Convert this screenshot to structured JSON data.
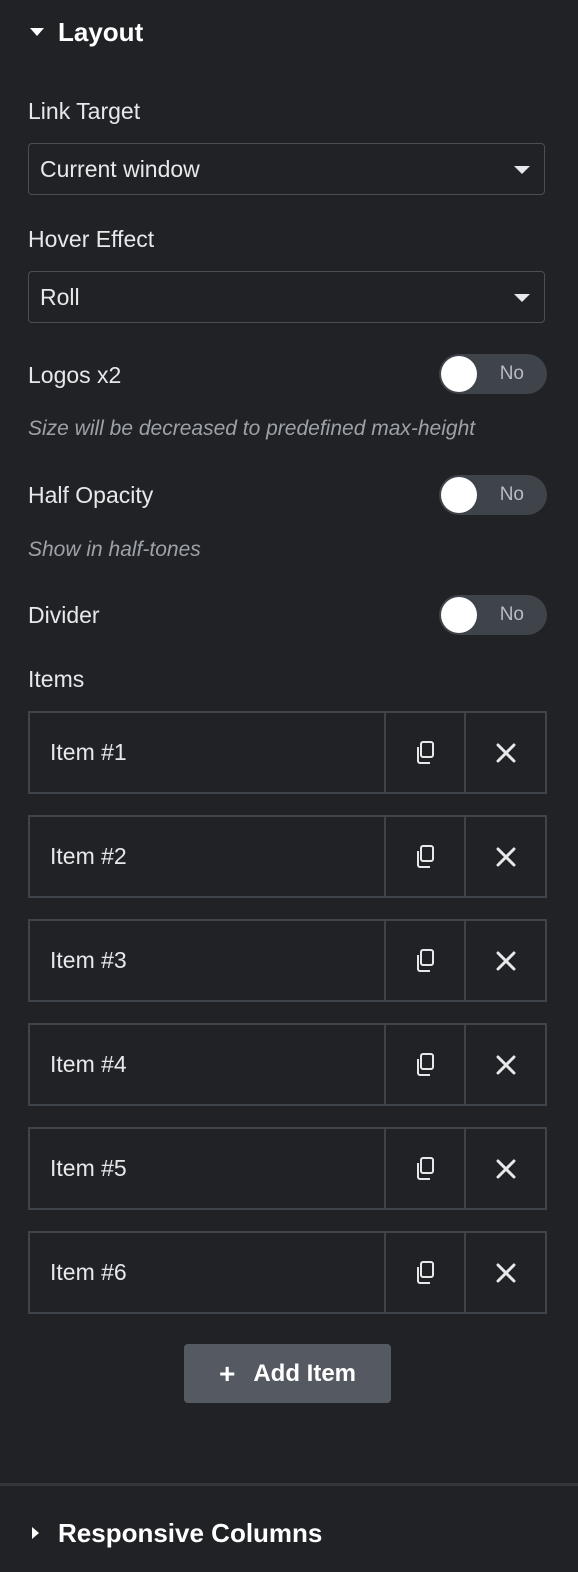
{
  "section": {
    "title": "Layout"
  },
  "link_target": {
    "label": "Link Target",
    "value": "Current window"
  },
  "hover_effect": {
    "label": "Hover Effect",
    "value": "Roll"
  },
  "logos_x2": {
    "label": "Logos x2",
    "toggle": "No",
    "hint": "Size will be decreased to predefined max-height"
  },
  "half_opacity": {
    "label": "Half Opacity",
    "toggle": "No",
    "hint": "Show in half-tones"
  },
  "divider_opt": {
    "label": "Divider",
    "toggle": "No"
  },
  "items": {
    "label": "Items",
    "list": [
      {
        "title": "Item #1"
      },
      {
        "title": "Item #2"
      },
      {
        "title": "Item #3"
      },
      {
        "title": "Item #4"
      },
      {
        "title": "Item #5"
      },
      {
        "title": "Item #6"
      }
    ],
    "add_label": "Add Item",
    "add_icon": "+"
  },
  "footer": {
    "title": "Responsive Columns"
  },
  "colors": {
    "background": "#202226",
    "border": "#3f434a",
    "button": "#555a62",
    "text": "#e6e8ea",
    "hint": "#9da1a8"
  },
  "icons": {
    "section_toggle": "caret-down-icon",
    "duplicate": "duplicate-icon",
    "remove": "close-icon",
    "footer_toggle": "caret-right-icon"
  }
}
